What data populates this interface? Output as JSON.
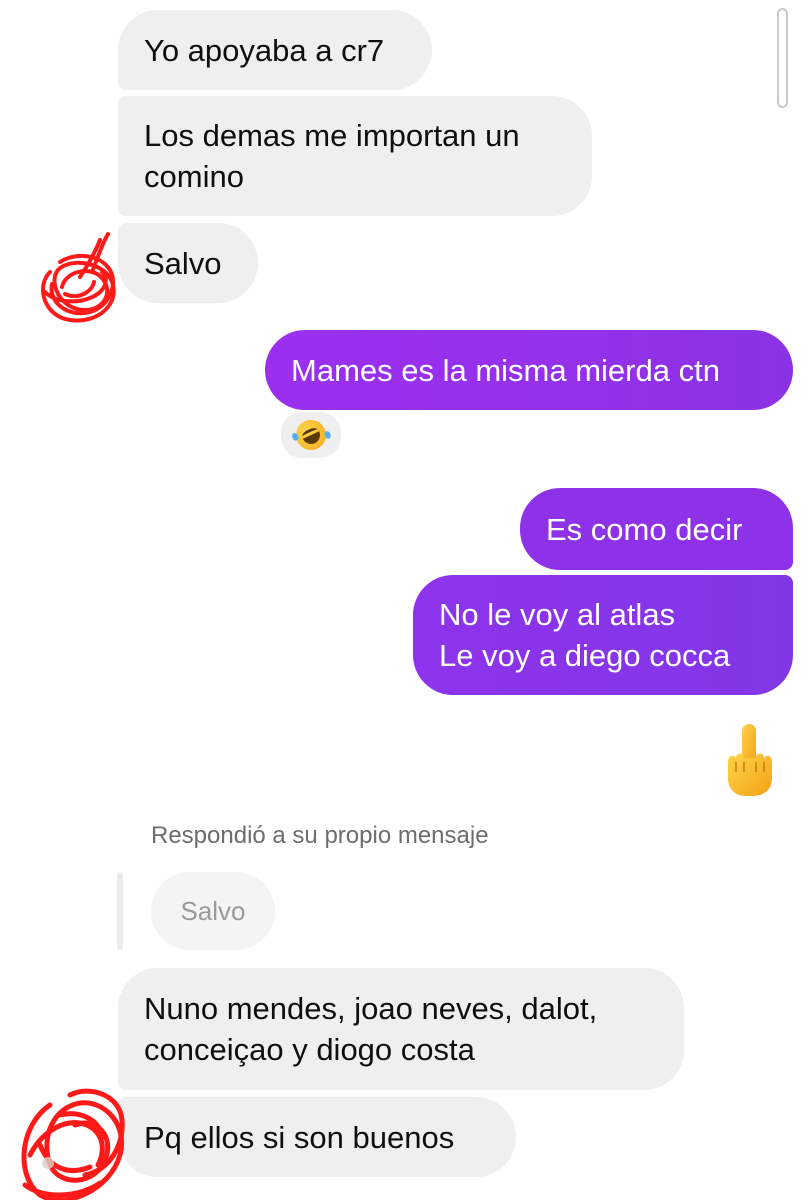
{
  "thread": {
    "messages": [
      {
        "sender": "them",
        "lines": [
          "Yo apoyaba a cr7"
        ]
      },
      {
        "sender": "them",
        "lines": [
          "Los demas me importan un",
          "comino"
        ]
      },
      {
        "sender": "them",
        "lines": [
          "Salvo"
        ]
      },
      {
        "sender": "me",
        "lines": [
          "Mames es la misma mierda ctn"
        ],
        "reaction_icon": "rolling-on-floor-laughing-emoji"
      },
      {
        "sender": "me",
        "lines": [
          "Es como decir"
        ]
      },
      {
        "sender": "me",
        "lines": [
          "No le voy al atlas",
          "Le voy a diego cocca"
        ]
      },
      {
        "sender": "me",
        "emoji_icon": "middle-finger-emoji"
      },
      {
        "sender": "them",
        "lines": [
          "Nuno mendes, joao neves, dalot,",
          "conceiçao y diogo costa"
        ]
      },
      {
        "sender": "them",
        "lines": [
          "Pq ellos si son buenos"
        ]
      }
    ],
    "reply_context": {
      "label": "Respondió a su propio mensaje",
      "quoted_text": "Salvo"
    }
  },
  "colors": {
    "incoming_bubble": "#efefef",
    "outgoing_bubble": "#9431eb",
    "scribble": "#ff1a1a"
  }
}
